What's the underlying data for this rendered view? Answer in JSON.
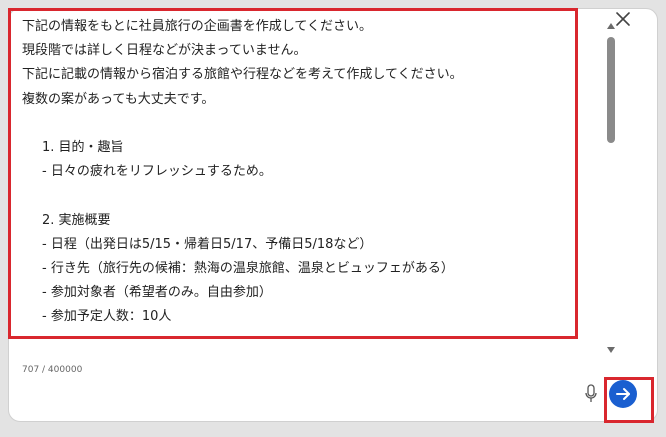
{
  "prompt": {
    "lines": [
      {
        "text": "下記の情報をもとに社員旅行の企画書を作成してください。",
        "indent": false
      },
      {
        "text": "現段階では詳しく日程などが決まっていません。",
        "indent": false
      },
      {
        "text": "下記に記載の情報から宿泊する旅館や行程などを考えて作成してください。",
        "indent": false
      },
      {
        "text": "複数の案があっても大丈夫です。",
        "indent": false
      },
      {
        "text": "",
        "indent": false
      },
      {
        "text": "1. 目的・趣旨",
        "indent": true
      },
      {
        "text": "- 日々の疲れをリフレッシュするため。",
        "indent": true
      },
      {
        "text": "",
        "indent": false
      },
      {
        "text": "2. 実施概要",
        "indent": true
      },
      {
        "text": "- 日程（出発日は5/15・帰着日5/17、予備日5/18など）",
        "indent": true
      },
      {
        "text": "- 行き先（旅行先の候補：熱海の温泉旅館、温泉とビュッフェがある）",
        "indent": true
      },
      {
        "text": "- 参加対象者（希望者のみ。自由参加）",
        "indent": true
      },
      {
        "text": "- 参加予定人数：10人",
        "indent": true
      }
    ]
  },
  "counter": {
    "text": "707 / 400000"
  },
  "icons": {
    "close": "close-icon",
    "mic": "microphone-icon",
    "send": "arrow-right-icon"
  },
  "colors": {
    "accent": "#1a5fd0",
    "highlight": "#d9272e"
  }
}
